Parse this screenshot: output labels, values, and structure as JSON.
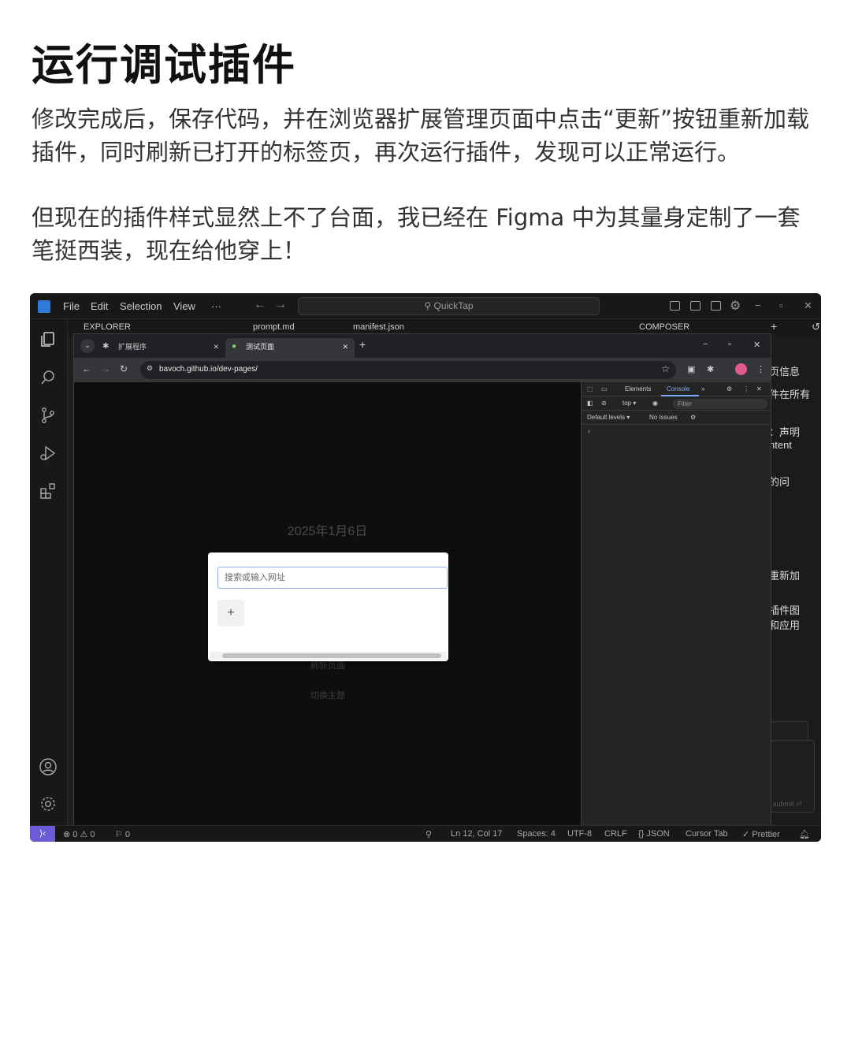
{
  "article": {
    "title": "运行调试插件",
    "paragraph1": "修改完成后，保存代码，并在浏览器扩展管理页面中点击“更新”按钮重新加载插件，同时刷新已打开的标签页，再次运行插件，发现可以正常运行。",
    "paragraph2": "但现在的插件样式显然上不了台面，我已经在 Figma 中为其量身定制了一套笔挺西装，现在给他穿上！"
  },
  "vscode": {
    "menu": [
      "File",
      "Edit",
      "Selection",
      "View",
      "···"
    ],
    "search_label": "QuickTap",
    "tabs": {
      "explorer": "EXPLORER",
      "tab1": "prompt.md",
      "tab2": "manifest.json",
      "composer": "COMPOSER"
    },
    "side_snippets": [
      "页信息",
      "件在所有",
      "：声明",
      "ntent",
      "的问",
      "重新加",
      "插件图",
      "和应用"
    ],
    "submit_label": "submit ⏎",
    "status": {
      "remote": "⟩‹",
      "problems": "⊗ 0 ⚠ 0",
      "ports": "⚐ 0",
      "position": "Ln 12, Col 17",
      "spaces": "Spaces: 4",
      "encoding": "UTF-8",
      "eol": "CRLF",
      "language": "{} JSON",
      "tab_mode": "Cursor Tab",
      "formatter": "✓ Prettier"
    }
  },
  "browser": {
    "tab1": "扩展程序",
    "tab2": "测试页面",
    "url": "bavoch.github.io/dev-pages/",
    "page": {
      "date": "2025年1月6日",
      "refresh_button": "刷新页面",
      "theme_button": "切换主题"
    },
    "popup": {
      "placeholder": "搜索或输入网址",
      "add_label": "+"
    },
    "devtools": {
      "tab_elements": "Elements",
      "tab_console": "Console",
      "context": "top ▾",
      "filter": "Filter",
      "levels": "Default levels ▾",
      "issues": "No Issues"
    }
  },
  "colors": {
    "accent_remote": "#6b5bd6",
    "devtools_active": "#7cacf8",
    "popup_input_border": "#90aef0"
  }
}
